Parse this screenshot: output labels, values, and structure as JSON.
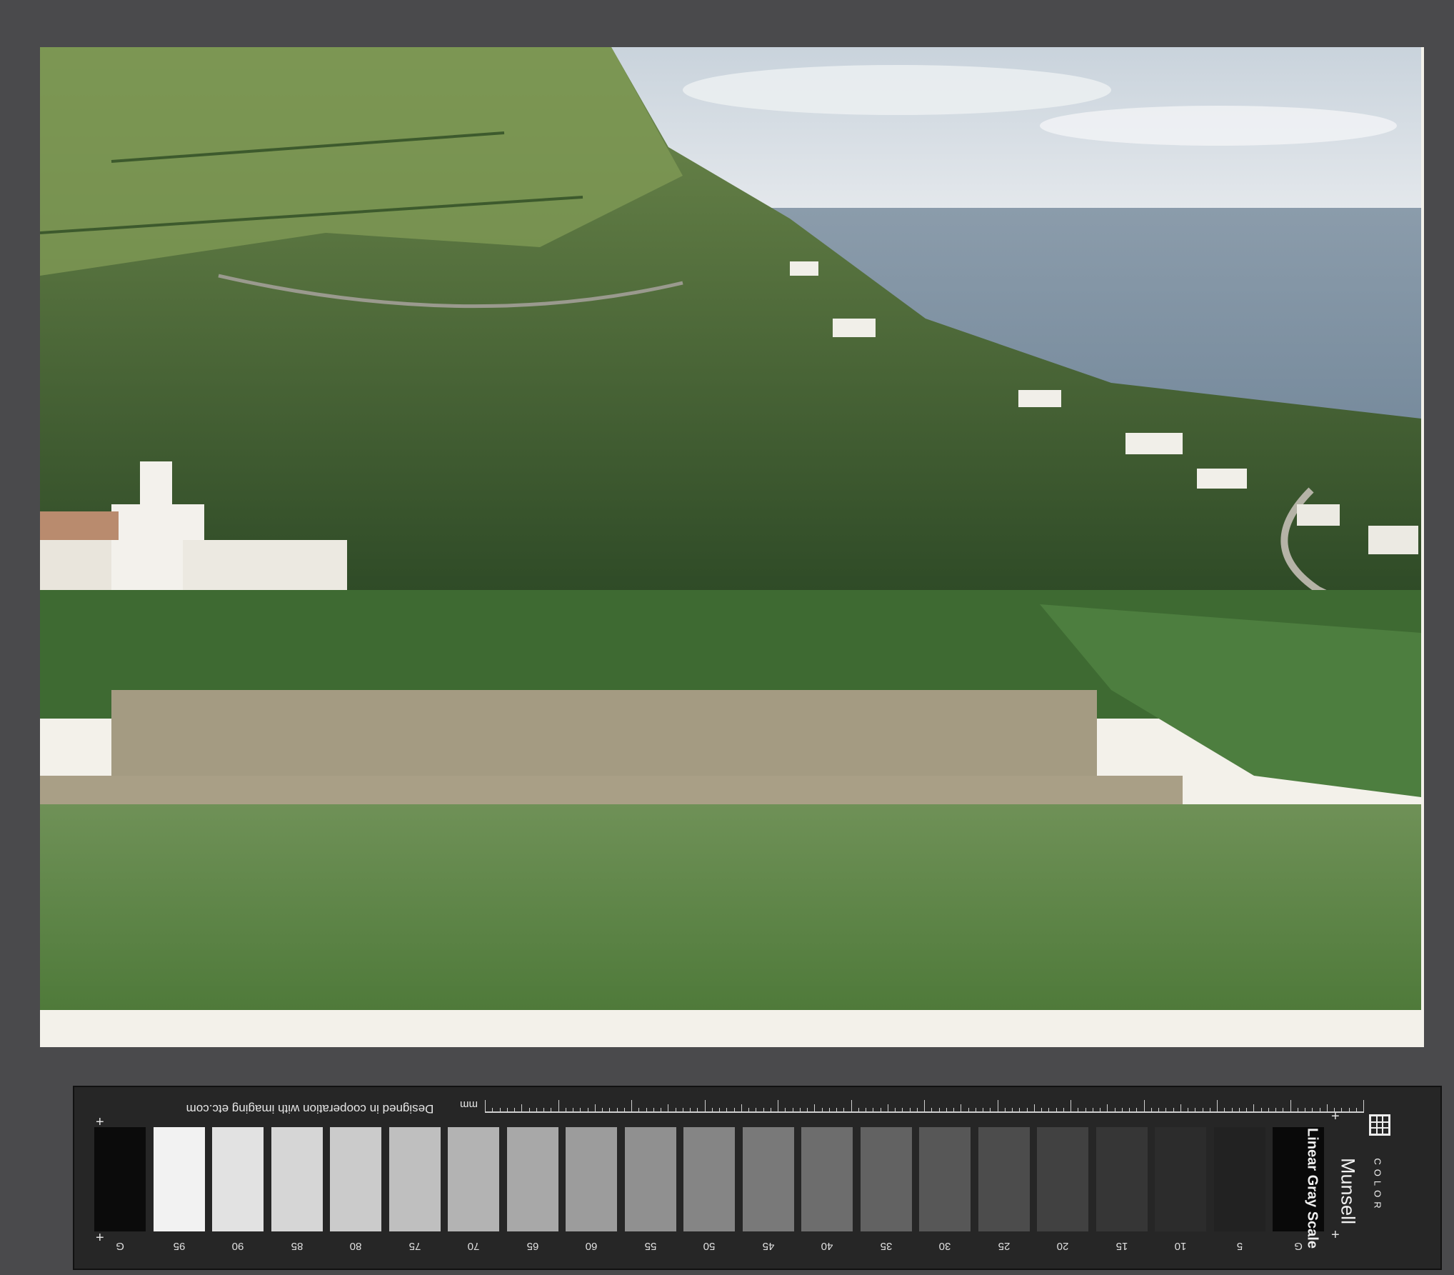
{
  "photo": {
    "subject": "coastal village with terraced fields and sea"
  },
  "target": {
    "credit": "Designed in cooperation with imaging etc.com",
    "ruler_unit": "mm",
    "brand": "Munsell",
    "brand_sub": "COLOR",
    "product": "Linear Gray Scale",
    "patch_labels": [
      "G",
      "95",
      "90",
      "85",
      "80",
      "75",
      "70",
      "65",
      "60",
      "55",
      "50",
      "45",
      "40",
      "35",
      "30",
      "25",
      "20",
      "15",
      "10",
      "5",
      "G"
    ],
    "patch_colors": [
      "#0b0b0b",
      "#f2f2f2",
      "#e2e2e2",
      "#d6d6d6",
      "#cbcbcb",
      "#bfbfbf",
      "#b3b3b3",
      "#a8a8a8",
      "#9c9c9c",
      "#909090",
      "#858585",
      "#797979",
      "#6d6d6d",
      "#626262",
      "#575757",
      "#4c4c4c",
      "#414141",
      "#363636",
      "#2c2c2c",
      "#222222",
      "#090909"
    ]
  }
}
